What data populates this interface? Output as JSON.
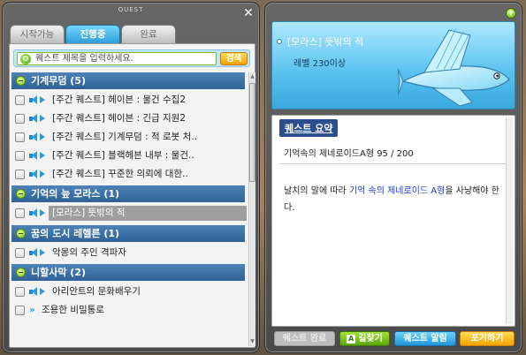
{
  "window": {
    "title": "QUEST"
  },
  "tabs": [
    {
      "label": "시작가능",
      "active": false
    },
    {
      "label": "진행중",
      "active": true
    },
    {
      "label": "완료",
      "active": false
    }
  ],
  "search": {
    "placeholder": "퀘스트 제목을 입력하세요.",
    "button_label": "검색"
  },
  "regions": [
    {
      "title": "기계무덤 (5)",
      "quests": [
        {
          "label": "[주간 퀘스트] 헤이븐 : 물건 수집2",
          "icon": "speaker-arrow-icon"
        },
        {
          "label": "[주간 퀘스트] 헤이븐 : 긴급 지원2",
          "icon": "speaker-arrow-icon"
        },
        {
          "label": "[주간 퀘스트] 기계무덤 : 적 로봇 처..",
          "icon": "speaker-arrow-icon"
        },
        {
          "label": "[주간 퀘스트] 블랙헤븐 내부 : 물건..",
          "icon": "speaker-arrow-icon"
        },
        {
          "label": "[주간 퀘스트] 꾸준한 의뢰에 대한..",
          "icon": "speaker-arrow-icon"
        }
      ]
    },
    {
      "title": "기억의 늪 모라스 (1)",
      "quests": [
        {
          "label": "[모라스] 뜻밖의 적",
          "icon": "speaker-arrow-icon",
          "selected": true
        }
      ]
    },
    {
      "title": "꿈의 도시 레헬른 (1)",
      "quests": [
        {
          "label": "악몽의 주인 격파자",
          "icon": "speaker-arrow-icon"
        }
      ]
    },
    {
      "title": "니할사막 (2)",
      "quests": [
        {
          "label": "아리안트의 문화배우기",
          "icon": "speaker-arrow-icon"
        },
        {
          "label": "조용한 비밀통로",
          "icon": "double-arrow-icon"
        }
      ]
    }
  ],
  "detail": {
    "quest_name": "[모라스] 뜻밖의 적",
    "level_req": "레벨 230이상",
    "summary_title": "퀘스트 요약",
    "progress": "기억속의 제네로이드A형 95 / 200",
    "description_parts": [
      {
        "text": "날치의 말에 따라 ",
        "highlight": false
      },
      {
        "text": "기억 속의 제네로이드 A형",
        "highlight": true
      },
      {
        "text": "을 사냥해야 한다.",
        "highlight": false
      }
    ]
  },
  "buttons": {
    "complete": "퀘스트 완료",
    "guide": "길찾기",
    "guide_key": "A",
    "alarm": "퀘스트 알림",
    "giveup": "포기하기"
  },
  "colors": {
    "header_blue": "#3a6ea5",
    "tab_active": "#2d9ed8",
    "banner": "#57c1ef",
    "highlight_text": "#1d3bd6",
    "search_button": "#f2a200"
  }
}
